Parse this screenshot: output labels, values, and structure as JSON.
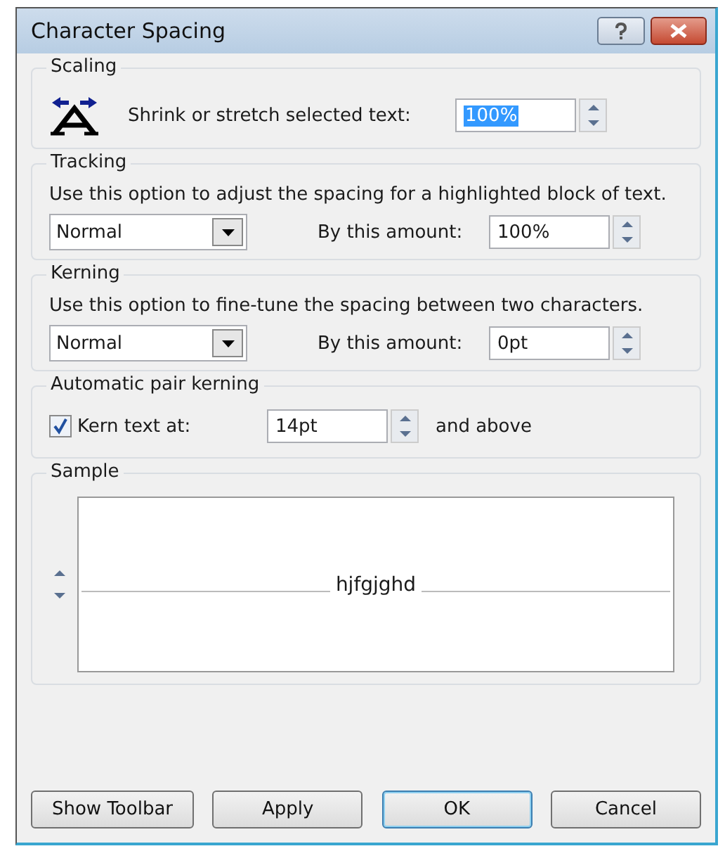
{
  "window": {
    "title": "Character Spacing"
  },
  "scaling": {
    "title": "Scaling",
    "label": "Shrink or stretch selected text:",
    "value": "100%",
    "value_selected": true
  },
  "tracking": {
    "title": "Tracking",
    "description": "Use this option to adjust the spacing for a highlighted block of text.",
    "dropdown": "Normal",
    "amount_label": "By this amount:",
    "value": "100%"
  },
  "kerning": {
    "title": "Kerning",
    "description": "Use this option to fine-tune the spacing between two characters.",
    "dropdown": "Normal",
    "amount_label": "By this amount:",
    "value": "0pt"
  },
  "pair_kerning": {
    "title": "Automatic pair kerning",
    "checked": true,
    "label": "Kern text at:",
    "value": "14pt",
    "suffix": "and above"
  },
  "sample": {
    "title": "Sample",
    "text": "hjfgjghd"
  },
  "buttons": [
    {
      "label": "Show Toolbar",
      "default": false
    },
    {
      "label": "Apply",
      "default": false
    },
    {
      "label": "OK",
      "default": true
    },
    {
      "label": "Cancel",
      "default": false
    }
  ]
}
